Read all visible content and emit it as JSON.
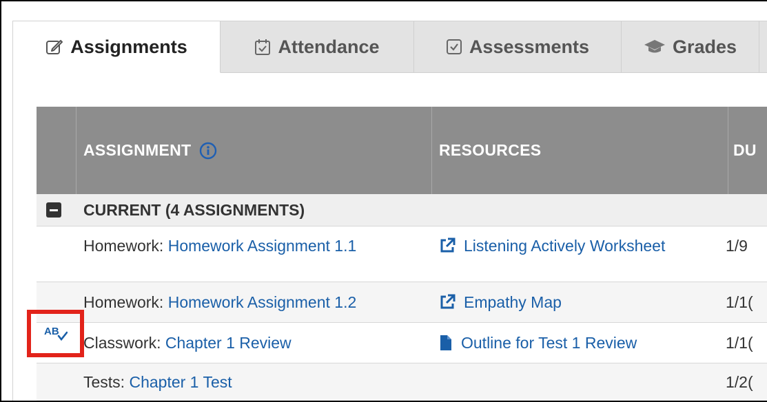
{
  "tabs": [
    {
      "label": "Assignments",
      "icon": "pencil-square-icon",
      "active": true
    },
    {
      "label": "Attendance",
      "icon": "calendar-check-icon",
      "active": false
    },
    {
      "label": "Assessments",
      "icon": "checkbox-icon",
      "active": false
    },
    {
      "label": "Grades",
      "icon": "graduation-cap-icon",
      "active": false
    }
  ],
  "table": {
    "headers": {
      "assignment": "ASSIGNMENT",
      "resources": "RESOURCES",
      "due": "DU"
    },
    "group": {
      "label": "CURRENT (4 ASSIGNMENTS)"
    },
    "rows": [
      {
        "type": "Homework:",
        "title": "Homework Assignment 1.1",
        "resource": "Listening Actively Worksheet",
        "resource_icon": "external-link-icon",
        "due": "1/9"
      },
      {
        "type": "Homework:",
        "title": "Homework Assignment 1.2",
        "resource": "Empathy Map",
        "resource_icon": "external-link-icon",
        "due": "1/1("
      },
      {
        "type": "Classwork:",
        "title": "Chapter 1 Review",
        "resource": "Outline for Test 1 Review",
        "resource_icon": "document-icon",
        "due": "1/1("
      },
      {
        "type": "Tests:",
        "title": "Chapter 1 Test",
        "resource": "",
        "resource_icon": "",
        "due": "1/2("
      }
    ]
  },
  "highlight": {
    "icon": "ab-check-icon",
    "label": "AB",
    "color": "#e2231a"
  },
  "colors": {
    "link": "#1a5fa8",
    "header_bg": "#8d8d8d",
    "tab_bg": "#e3e3e3"
  }
}
